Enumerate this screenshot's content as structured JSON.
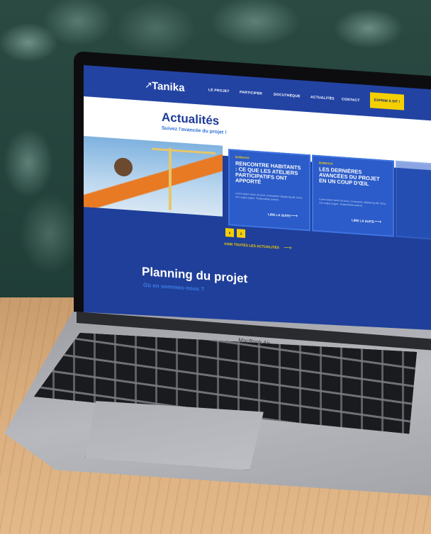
{
  "site": {
    "brand": "Tanika",
    "nav": [
      "LE PROJET",
      "PARTICIPER",
      "DOCUTHÈQUE",
      "ACTUALITÉS",
      "CONTACT"
    ],
    "cta": "EXPRIM À DIT !",
    "hero": {
      "title": "Actualités",
      "subtitle": "Suivez l'avancée du projet !"
    },
    "cards": [
      {
        "tag": "BUREAUX",
        "title": "RENCONTRE HABITANTS : CE QUE LES ATELIERS PARTICIPATIFS ONT APPORTÉ",
        "body": "Lorem ipsum dolor sit amet, consectetur adipiscing elit. Nunc non augue augue. Suspendisse potenti.",
        "link": "LIRE LA SUITE"
      },
      {
        "tag": "BUREAUX",
        "title": "LES DERNIÈRES AVANCÉES DU PROJET EN UN COUP D'ŒIL",
        "body": "Lorem ipsum dolor sit amet, consectetur adipiscing elit. Nunc non augue augue. Suspendisse potenti.",
        "link": "LIRE LA SUITE"
      }
    ],
    "see_all": "VOIR TOUTES LES ACTUALITÉS",
    "planning": {
      "title": "Planning du projet",
      "subtitle": "Où en sommes-nous ?"
    }
  },
  "device": {
    "label": "MacBook Air"
  },
  "colors": {
    "primary": "#2343a3",
    "accent": "#f5d000",
    "card": "#2b5cc9"
  },
  "icons": {
    "logo": "leaf-icon",
    "prev": "arrow-left-icon",
    "next": "arrow-right-icon"
  }
}
